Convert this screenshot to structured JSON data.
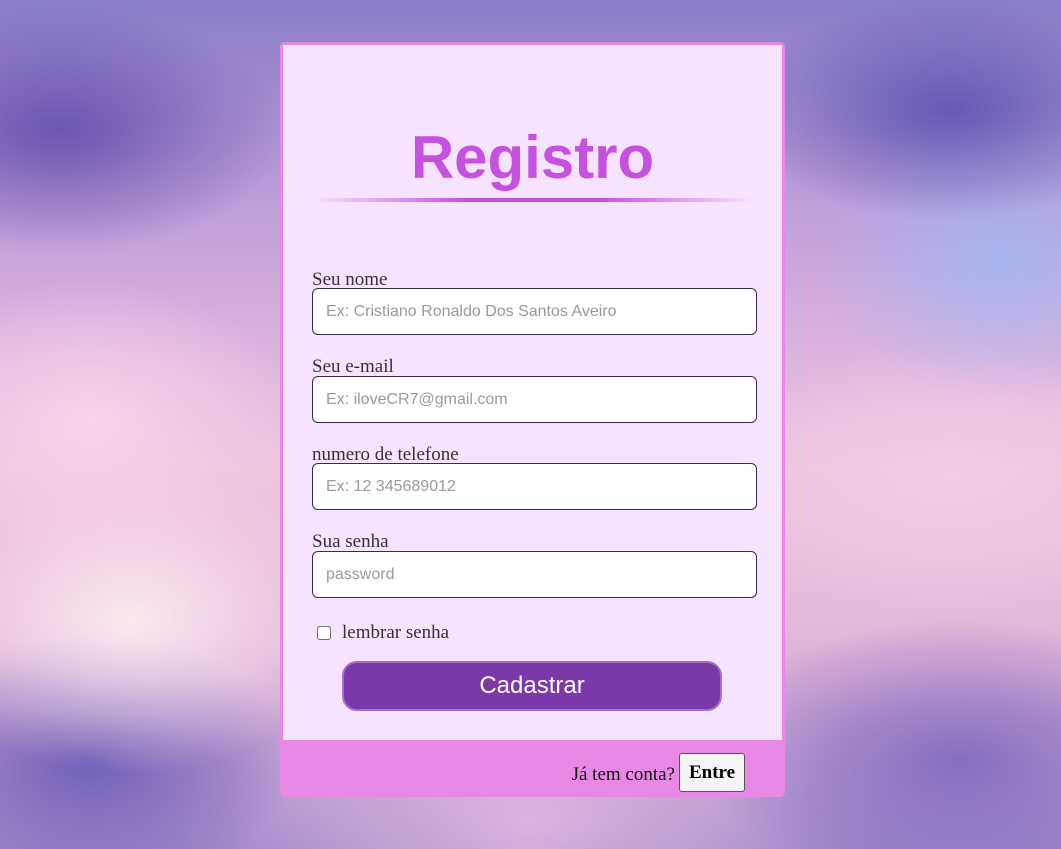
{
  "form": {
    "title": "Registro",
    "fields": [
      {
        "label": "Seu nome",
        "placeholder": "Ex: Cristiano Ronaldo Dos Santos Aveiro",
        "value": ""
      },
      {
        "label": "Seu e-mail",
        "placeholder": "Ex: iloveCR7@gmail.com",
        "value": ""
      },
      {
        "label": "numero de telefone",
        "placeholder": "Ex: 12 345689012",
        "value": ""
      },
      {
        "label": "Sua senha",
        "placeholder": "password",
        "value": ""
      }
    ],
    "remember": {
      "label": "lembrar senha",
      "checked": false
    },
    "submit_label": "Cadastrar"
  },
  "footer": {
    "prompt": "Já tem conta?",
    "login_label": "Entre"
  },
  "colors": {
    "title": "#c650e0",
    "card_background": "#f6e3ff",
    "card_border": "#e888e6",
    "button": "#7b38a8",
    "footer": "#e888e6"
  }
}
